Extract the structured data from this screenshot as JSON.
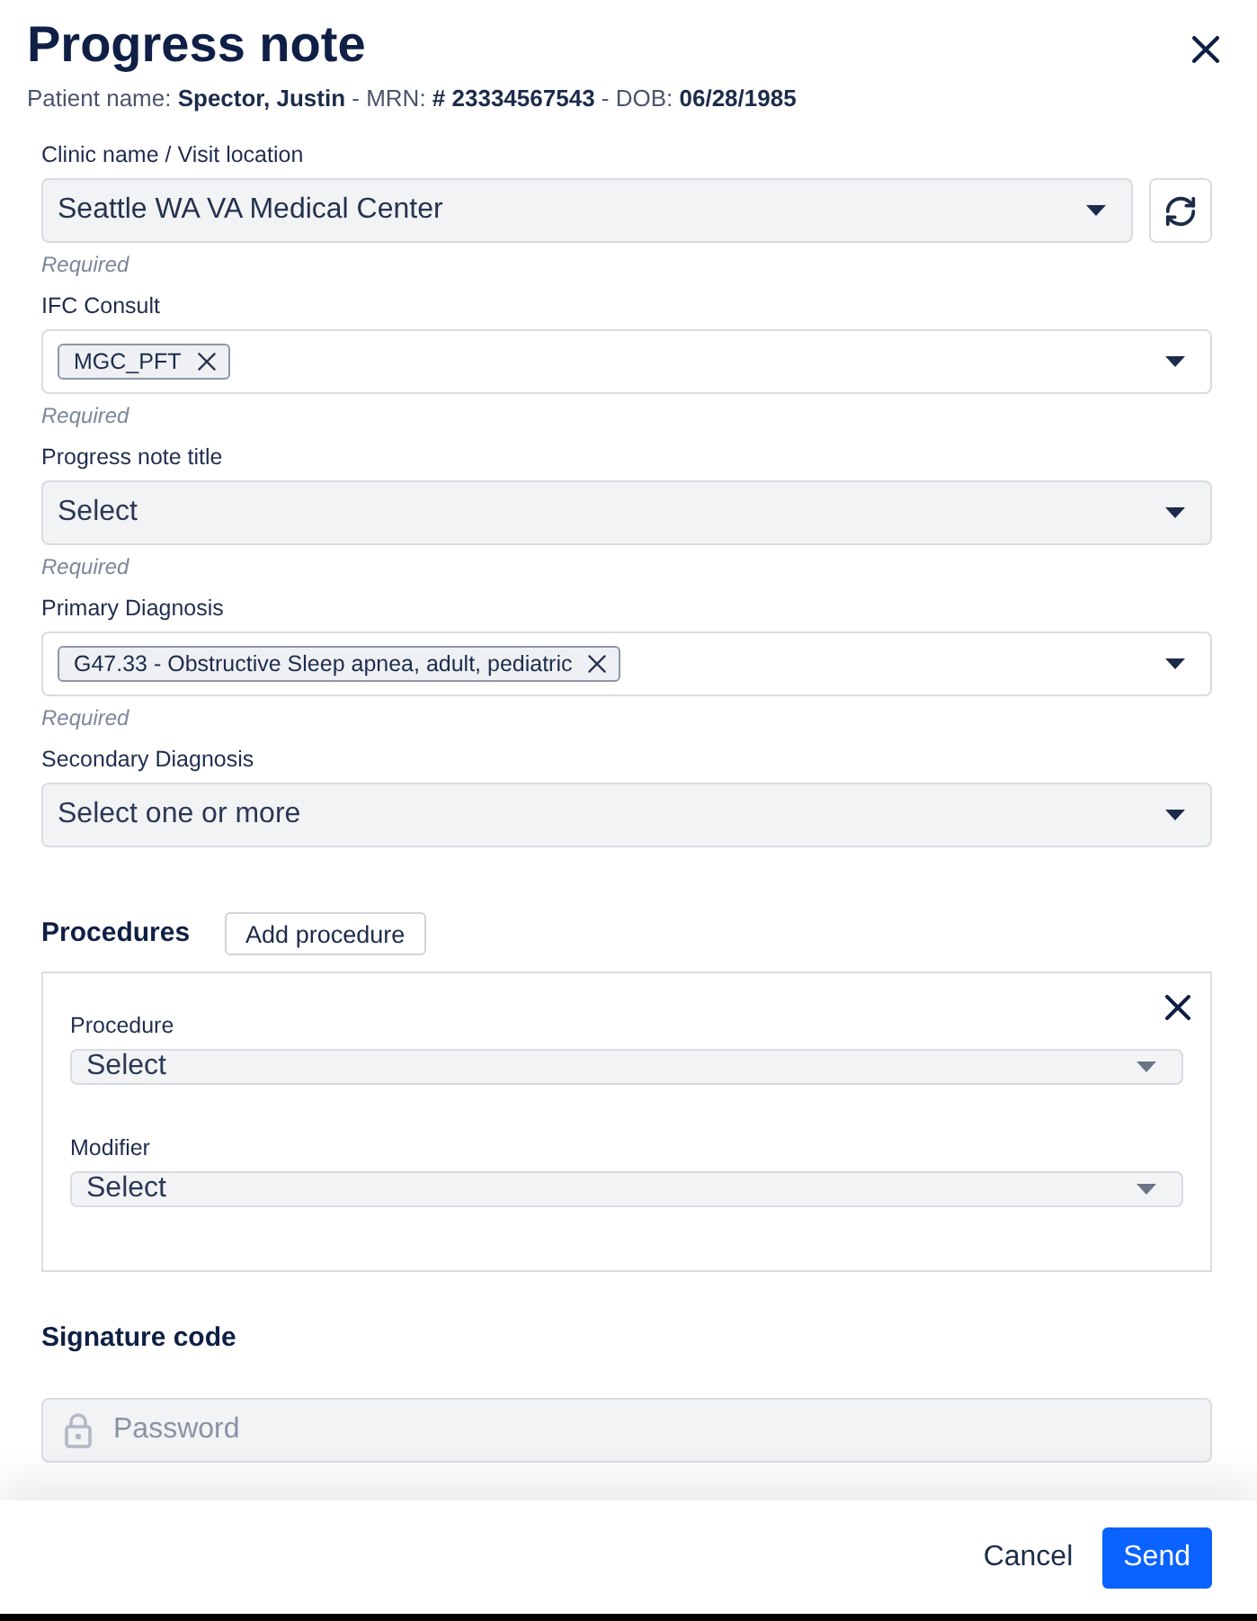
{
  "dialog": {
    "title": "Progress note",
    "patient_info": "Patient name: **Spector, Justin** - MRN: **# 23334567543** - DOB: **06/28/1985**"
  },
  "fields": [
    {
      "label": "Clinic name / Visit location",
      "kind": "select",
      "value": "Seattle WA VA Medical Center",
      "hint": "Required",
      "refresh_button": true
    },
    {
      "label": "IFC Consult",
      "kind": "multi",
      "tags": [
        "MGC_PFT"
      ],
      "hint": "Required"
    },
    {
      "label": "Progress note title",
      "kind": "select",
      "placeholder": "Select",
      "hint": "Required"
    },
    {
      "label": "Primary Diagnosis",
      "kind": "multi",
      "tags": [
        "G47.33 - Obstructive Sleep apnea, adult, pediatric"
      ],
      "hint": "Required"
    },
    {
      "label": "Secondary Diagnosis",
      "kind": "select",
      "placeholder": "Select one or more"
    }
  ],
  "procedures": {
    "title": "Procedures",
    "add_button": "Add procedure",
    "items": [
      {
        "fields": [
          {
            "label": "Procedure",
            "placeholder": "Select"
          },
          {
            "label": "Modifier",
            "placeholder": "Select"
          }
        ]
      }
    ]
  },
  "signature": {
    "title": "Signature code",
    "placeholder": "Password"
  },
  "footer": {
    "buttons": [
      {
        "label": "Cancel",
        "kind": "text"
      },
      {
        "label": "Send",
        "kind": "primary"
      }
    ]
  }
}
